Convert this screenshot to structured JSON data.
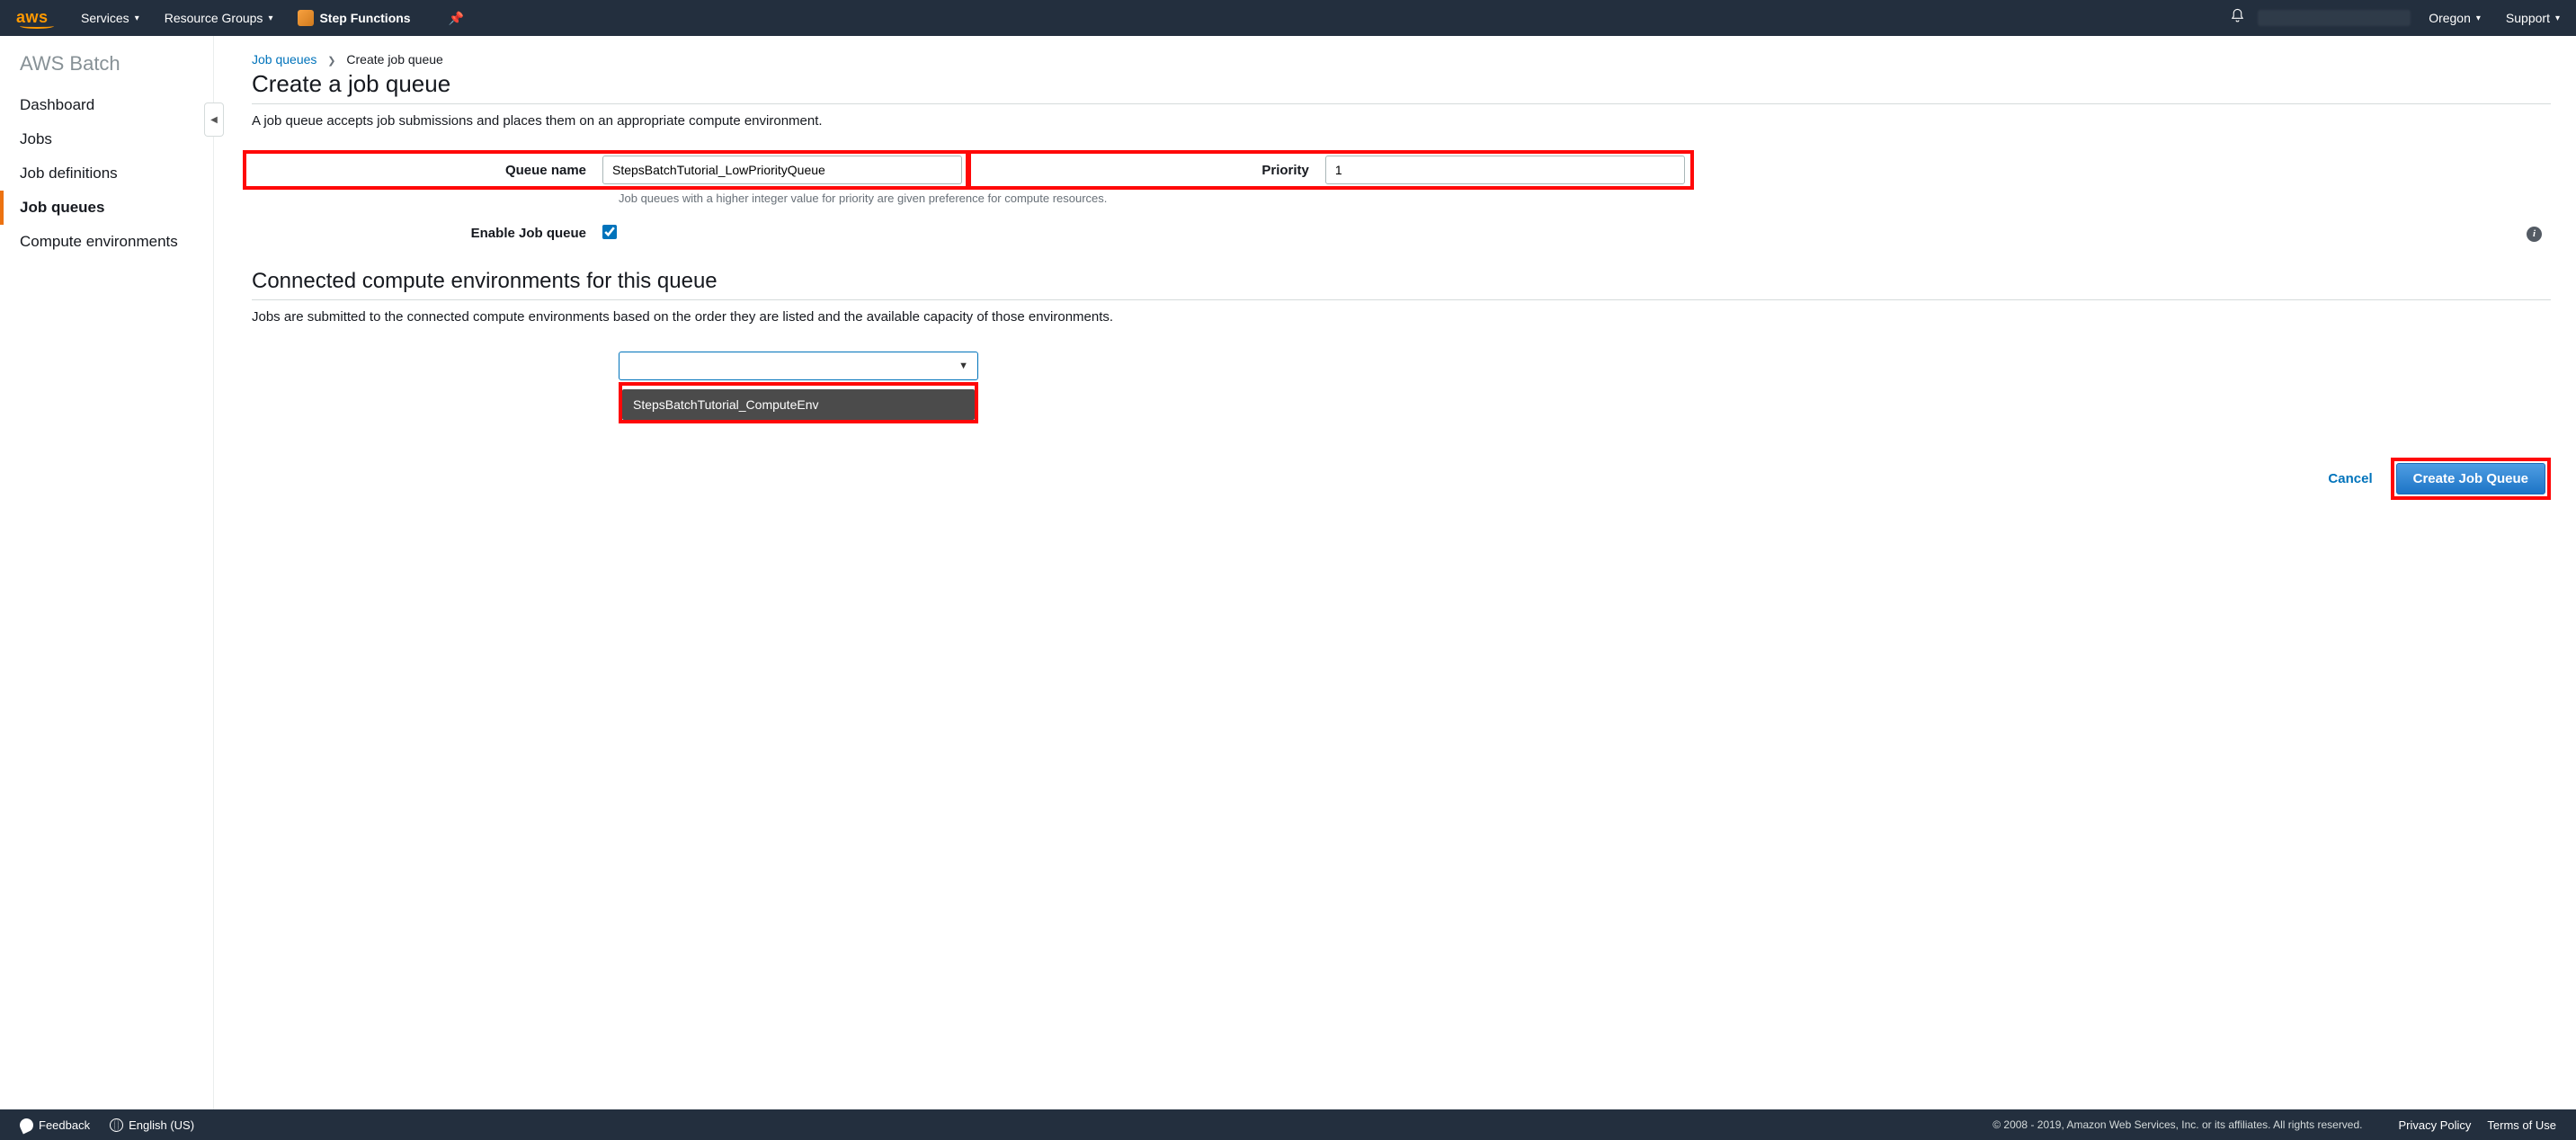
{
  "topnav": {
    "logo": "aws",
    "services": "Services",
    "resource_groups": "Resource Groups",
    "step_functions": "Step Functions",
    "region": "Oregon",
    "support": "Support"
  },
  "sidebar": {
    "title": "AWS Batch",
    "items": [
      {
        "label": "Dashboard"
      },
      {
        "label": "Jobs"
      },
      {
        "label": "Job definitions"
      },
      {
        "label": "Job queues"
      },
      {
        "label": "Compute environments"
      }
    ]
  },
  "breadcrumb": {
    "parent": "Job queues",
    "current": "Create job queue"
  },
  "page": {
    "title": "Create a job queue",
    "description": "A job queue accepts job submissions and places them on an appropriate compute environment."
  },
  "form": {
    "queue_name_label": "Queue name",
    "queue_name_value": "StepsBatchTutorial_LowPriorityQueue",
    "priority_label": "Priority",
    "priority_value": "1",
    "priority_help": "Job queues with a higher integer value for priority are given preference for compute resources.",
    "enable_label": "Enable Job queue",
    "enable_checked": true
  },
  "section": {
    "title": "Connected compute environments for this queue",
    "description": "Jobs are submitted to the connected compute environments based on the order they are listed and the available capacity of those environments.",
    "dropdown_option": "StepsBatchTutorial_ComputeEnv"
  },
  "actions": {
    "cancel": "Cancel",
    "create": "Create Job Queue"
  },
  "footer": {
    "feedback": "Feedback",
    "language": "English (US)",
    "copyright": "© 2008 - 2019, Amazon Web Services, Inc. or its affiliates. All rights reserved.",
    "privacy": "Privacy Policy",
    "terms": "Terms of Use"
  }
}
